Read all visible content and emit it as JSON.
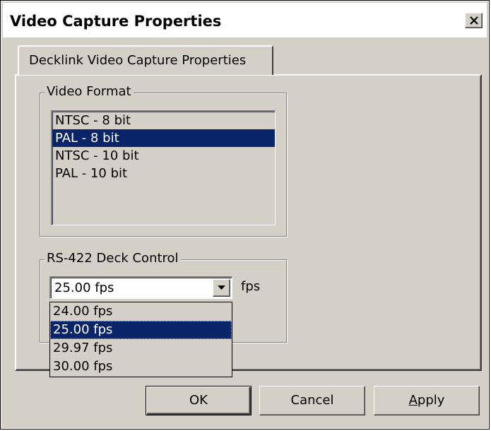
{
  "window": {
    "title": "Video Capture Properties",
    "close_icon": "close-icon"
  },
  "tab": {
    "label": "Decklink Video Capture Properties"
  },
  "video_format": {
    "legend": "Video Format",
    "items": [
      {
        "label": "NTSC - 8 bit",
        "selected": false
      },
      {
        "label": "PAL - 8 bit",
        "selected": true
      },
      {
        "label": "NTSC - 10 bit",
        "selected": false
      },
      {
        "label": "PAL - 10 bit",
        "selected": false
      }
    ]
  },
  "deck_control": {
    "legend": "RS-422 Deck Control",
    "selected_value": "25.00 fps",
    "unit_label": "fps",
    "options": [
      {
        "label": "24.00 fps",
        "selected": false
      },
      {
        "label": "25.00 fps",
        "selected": true
      },
      {
        "label": "29.97 fps",
        "selected": false
      },
      {
        "label": "30.00 fps",
        "selected": false
      }
    ]
  },
  "buttons": {
    "ok": "OK",
    "cancel": "Cancel",
    "apply": "Apply",
    "apply_mnemonic": "A",
    "apply_rest": "pply"
  },
  "colors": {
    "selection": "#0a246a",
    "face": "#d4d0c8"
  }
}
